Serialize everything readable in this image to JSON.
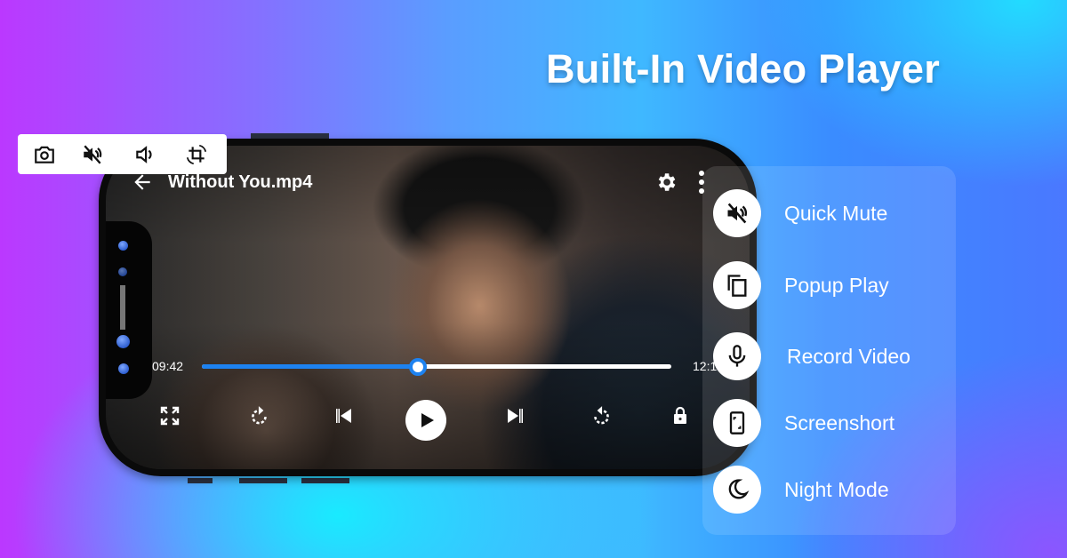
{
  "headline": "Built-In Video Player",
  "quick_toolbar": {
    "items": [
      {
        "icon": "camera-icon",
        "label": "Screenshot"
      },
      {
        "icon": "mute-icon",
        "label": "Mute"
      },
      {
        "icon": "volume-icon",
        "label": "Volume"
      },
      {
        "icon": "rotate-crop-icon",
        "label": "Rotate"
      }
    ]
  },
  "player": {
    "back_icon": "arrow-left-icon",
    "file_name": "Without You.mp4",
    "settings_icon": "gear-icon",
    "more_icon": "more-vertical-icon",
    "elapsed": "09:42",
    "duration": "12:1",
    "progress_percent": 46,
    "accent_color": "#1d82f0",
    "controls": [
      {
        "icon": "fullscreen-icon"
      },
      {
        "icon": "rotate-forward-icon"
      },
      {
        "icon": "skip-previous-icon"
      },
      {
        "icon": "play-icon"
      },
      {
        "icon": "skip-next-icon"
      },
      {
        "icon": "rotate-back-icon"
      },
      {
        "icon": "lock-icon"
      }
    ]
  },
  "features": [
    {
      "icon": "mute-icon",
      "label": "Quick Mute"
    },
    {
      "icon": "popup-copy-icon",
      "label": "Popup Play"
    },
    {
      "icon": "microphone-icon",
      "label": "Record Video"
    },
    {
      "icon": "phone-screenshot-icon",
      "label": "Screenshort"
    },
    {
      "icon": "moon-icon",
      "label": "Night Mode"
    }
  ]
}
